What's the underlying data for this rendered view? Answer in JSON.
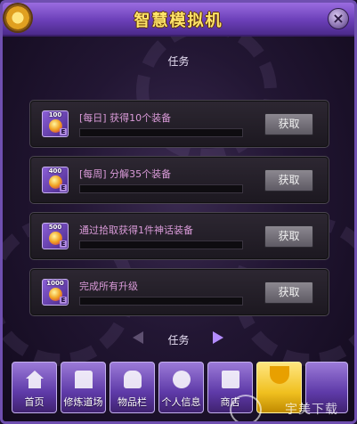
{
  "window": {
    "title": "智慧模拟机",
    "close_glyph": "×"
  },
  "section_title": "任务",
  "tasks": [
    {
      "icon_value": "100",
      "label": "[每日] 获得10个装备",
      "progress": 0,
      "claim_label": "获取"
    },
    {
      "icon_value": "400",
      "label": "[每周] 分解35个装备",
      "progress": 0,
      "claim_label": "获取"
    },
    {
      "icon_value": "500",
      "label": "通过拾取获得1件神话装备",
      "progress": 0,
      "claim_label": "获取"
    },
    {
      "icon_value": "1000",
      "label": "完成所有升级",
      "progress": 0,
      "claim_label": "获取"
    }
  ],
  "icon_badge": "E",
  "pager": {
    "label": "任务"
  },
  "nav": [
    {
      "label": "首页",
      "icon": "home-icon"
    },
    {
      "label": "修炼道场",
      "icon": "gate-icon"
    },
    {
      "label": "物品栏",
      "icon": "bag-icon"
    },
    {
      "label": "个人信息",
      "icon": "person-icon"
    },
    {
      "label": "商店",
      "icon": "shop-icon"
    },
    {
      "label": "",
      "icon": "shield-icon",
      "active": true
    }
  ],
  "watermark": "宇美下载",
  "colors": {
    "title": "#ffe46a",
    "task_label": "#d99ad8",
    "active_tab": "#f0c020"
  }
}
